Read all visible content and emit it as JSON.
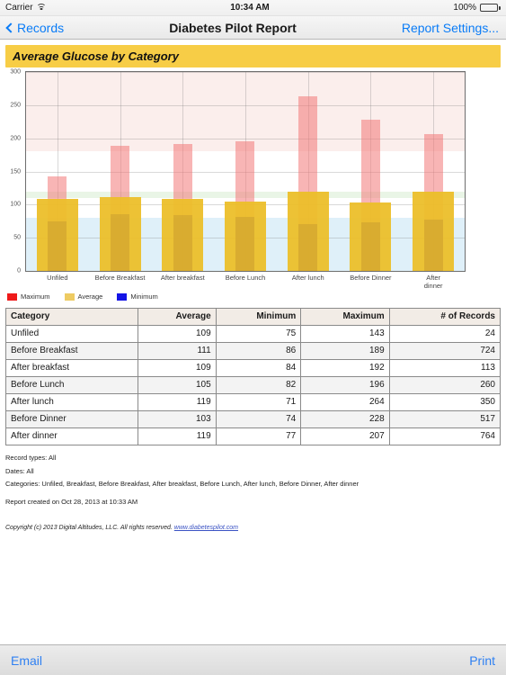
{
  "statusbar": {
    "carrier": "Carrier",
    "wifi_icon": "wifi-icon",
    "time": "10:34 AM",
    "battery_percent": "100%",
    "battery_icon": "battery-full-icon"
  },
  "navbar": {
    "back_label": "Records",
    "back_icon": "chevron-left-icon",
    "title": "Diabetes Pilot Report",
    "settings_label": "Report Settings..."
  },
  "report": {
    "section_title": "Average Glucose by Category"
  },
  "chart_data": {
    "type": "bar",
    "title": "Average Glucose by Category",
    "xlabel": "",
    "ylabel": "",
    "ylim": [
      0,
      300
    ],
    "yticks": [
      0,
      50,
      100,
      150,
      200,
      250,
      300
    ],
    "ytick_labels": [
      "0",
      "50",
      "100",
      "150",
      "200",
      "250",
      "300"
    ],
    "grid": true,
    "legend_position": "below",
    "categories": [
      "Unfiled",
      "Before Breakfast",
      "After breakfast",
      "Before Lunch",
      "After lunch",
      "Before Dinner",
      "After dinner"
    ],
    "series": [
      {
        "name": "Maximum",
        "color": "#f27878",
        "values": [
          143,
          189,
          192,
          196,
          264,
          228,
          207
        ]
      },
      {
        "name": "Average",
        "color": "#ecbe28",
        "values": [
          109,
          111,
          109,
          105,
          119,
          103,
          119
        ]
      },
      {
        "name": "Minimum",
        "color": "#1414e6",
        "values": [
          75,
          86,
          84,
          82,
          71,
          74,
          77
        ]
      }
    ],
    "bands": [
      {
        "name": "high-range",
        "from": 180,
        "to": 300,
        "color": "#fbeeec"
      },
      {
        "name": "target-upper",
        "from": 120,
        "to": 180,
        "color": "#ffffff"
      },
      {
        "name": "in-target",
        "from": 110,
        "to": 120,
        "color": "#e9f5e6"
      },
      {
        "name": "target-lower",
        "from": 80,
        "to": 110,
        "color": "#ffffff"
      },
      {
        "name": "low-range",
        "from": 0,
        "to": 80,
        "color": "#dff0f9"
      }
    ]
  },
  "legend": [
    {
      "label": "Maximum",
      "color": "#ef1a1a"
    },
    {
      "label": "Average",
      "color": "#eecb62"
    },
    {
      "label": "Minimum",
      "color": "#1414e6"
    }
  ],
  "table": {
    "columns": [
      "Category",
      "Average",
      "Minimum",
      "Maximum",
      "# of Records"
    ],
    "rows": [
      {
        "category": "Unfiled",
        "average": "109",
        "minimum": "75",
        "maximum": "143",
        "records": "24"
      },
      {
        "category": "Before Breakfast",
        "average": "111",
        "minimum": "86",
        "maximum": "189",
        "records": "724"
      },
      {
        "category": "After breakfast",
        "average": "109",
        "minimum": "84",
        "maximum": "192",
        "records": "113"
      },
      {
        "category": "Before Lunch",
        "average": "105",
        "minimum": "82",
        "maximum": "196",
        "records": "260"
      },
      {
        "category": "After lunch",
        "average": "119",
        "minimum": "71",
        "maximum": "264",
        "records": "350"
      },
      {
        "category": "Before Dinner",
        "average": "103",
        "minimum": "74",
        "maximum": "228",
        "records": "517"
      },
      {
        "category": "After dinner",
        "average": "119",
        "minimum": "77",
        "maximum": "207",
        "records": "764"
      }
    ]
  },
  "notes": {
    "record_types": "Record types: All",
    "dates": "Dates: All",
    "categories": "Categories: Unfiled, Breakfast, Before Breakfast, After breakfast, Before Lunch, After lunch, Before Dinner, After dinner",
    "created": "Report created on Oct 28, 2013 at 10:33 AM"
  },
  "copyright": {
    "text": "Copyright (c) 2013 Digital Altitudes, LLC. All rights reserved. ",
    "link": "www.diabetespilot.com"
  },
  "toolbar": {
    "email_label": "Email",
    "print_label": "Print"
  }
}
